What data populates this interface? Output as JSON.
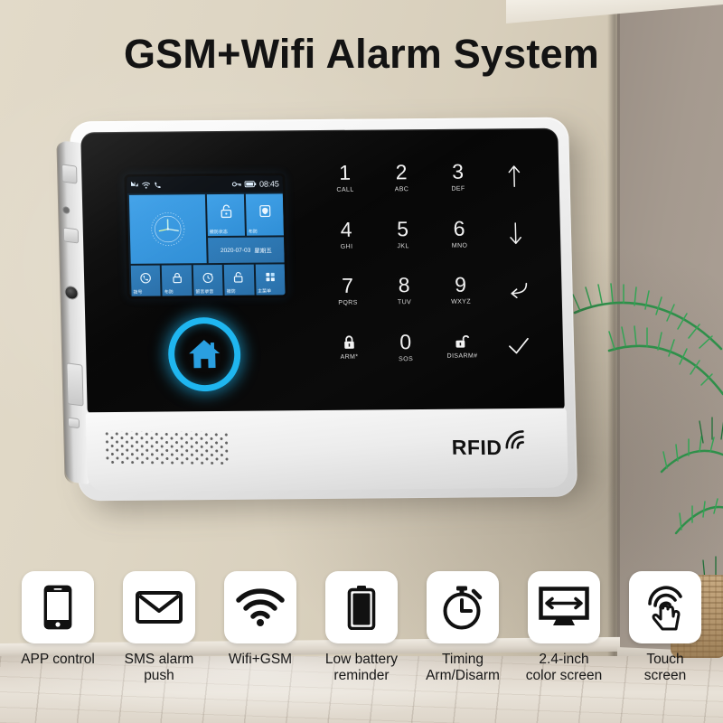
{
  "title": "GSM+Wifi Alarm System",
  "device": {
    "brand_mark": "RFID",
    "lcd": {
      "status": {
        "signal_icon": "cellular-signal-icon",
        "wifi_icon": "wifi-icon",
        "phone_icon": "phone-handset-icon",
        "key_icon": "key-icon",
        "battery_icon": "battery-icon",
        "time": "08:45"
      },
      "clock_tile": {
        "name": "analog-clock-tile"
      },
      "tiles": [
        {
          "icon": "unlock-icon",
          "label": "撤防状态"
        },
        {
          "icon": "shield-icon",
          "label": "布防"
        }
      ],
      "date_tile": {
        "date": "2020-07-03",
        "weekday": "星期五"
      },
      "bottom_tiles": [
        {
          "icon": "phone-icon",
          "label": "拨号"
        },
        {
          "icon": "lock-icon",
          "label": "布防"
        },
        {
          "icon": "timer-icon",
          "label": "留言录音"
        },
        {
          "icon": "unlock-icon",
          "label": "撤防"
        },
        {
          "icon": "apps-grid-icon",
          "label": "主菜单"
        }
      ]
    },
    "home_button": {
      "icon": "home-icon",
      "ring_color": "#1fb6f0"
    },
    "keypad": [
      {
        "num": "1",
        "sub": "CALL",
        "glyph": ""
      },
      {
        "num": "2",
        "sub": "ABC",
        "glyph": ""
      },
      {
        "num": "3",
        "sub": "DEF",
        "glyph": ""
      },
      {
        "num": "",
        "sub": "",
        "glyph": "arrow-up-icon"
      },
      {
        "num": "4",
        "sub": "GHI",
        "glyph": ""
      },
      {
        "num": "5",
        "sub": "JKL",
        "glyph": ""
      },
      {
        "num": "6",
        "sub": "MNO",
        "glyph": ""
      },
      {
        "num": "",
        "sub": "",
        "glyph": "arrow-down-icon"
      },
      {
        "num": "7",
        "sub": "PQRS",
        "glyph": ""
      },
      {
        "num": "8",
        "sub": "TUV",
        "glyph": ""
      },
      {
        "num": "9",
        "sub": "WXYZ",
        "glyph": ""
      },
      {
        "num": "",
        "sub": "",
        "glyph": "back-arrow-icon"
      },
      {
        "num": "",
        "sub": "ARM*",
        "glyph": "lock-icon"
      },
      {
        "num": "0",
        "sub": "SOS",
        "glyph": ""
      },
      {
        "num": "",
        "sub": "DISARM#",
        "glyph": "unlock-icon"
      },
      {
        "num": "",
        "sub": "",
        "glyph": "check-icon"
      }
    ]
  },
  "features": [
    {
      "icon": "smartphone-icon",
      "label": "APP control"
    },
    {
      "icon": "envelope-icon",
      "label": "SMS alarm\npush"
    },
    {
      "icon": "wifi-icon",
      "label": "Wifi+GSM"
    },
    {
      "icon": "battery-icon",
      "label": "Low battery\nreminder"
    },
    {
      "icon": "stopwatch-icon",
      "label": "Timing\nArm/Disarm"
    },
    {
      "icon": "monitor-width-icon",
      "label": "2.4-inch\ncolor screen"
    },
    {
      "icon": "touch-hand-icon",
      "label": "Touch\nscreen"
    }
  ],
  "colors": {
    "accent": "#1fb6f0",
    "lcd_tile": "#3ea0e8",
    "wall_left": "#ded6c4",
    "wall_right": "#a59a8f",
    "plant_green": "#2f8f4a"
  }
}
